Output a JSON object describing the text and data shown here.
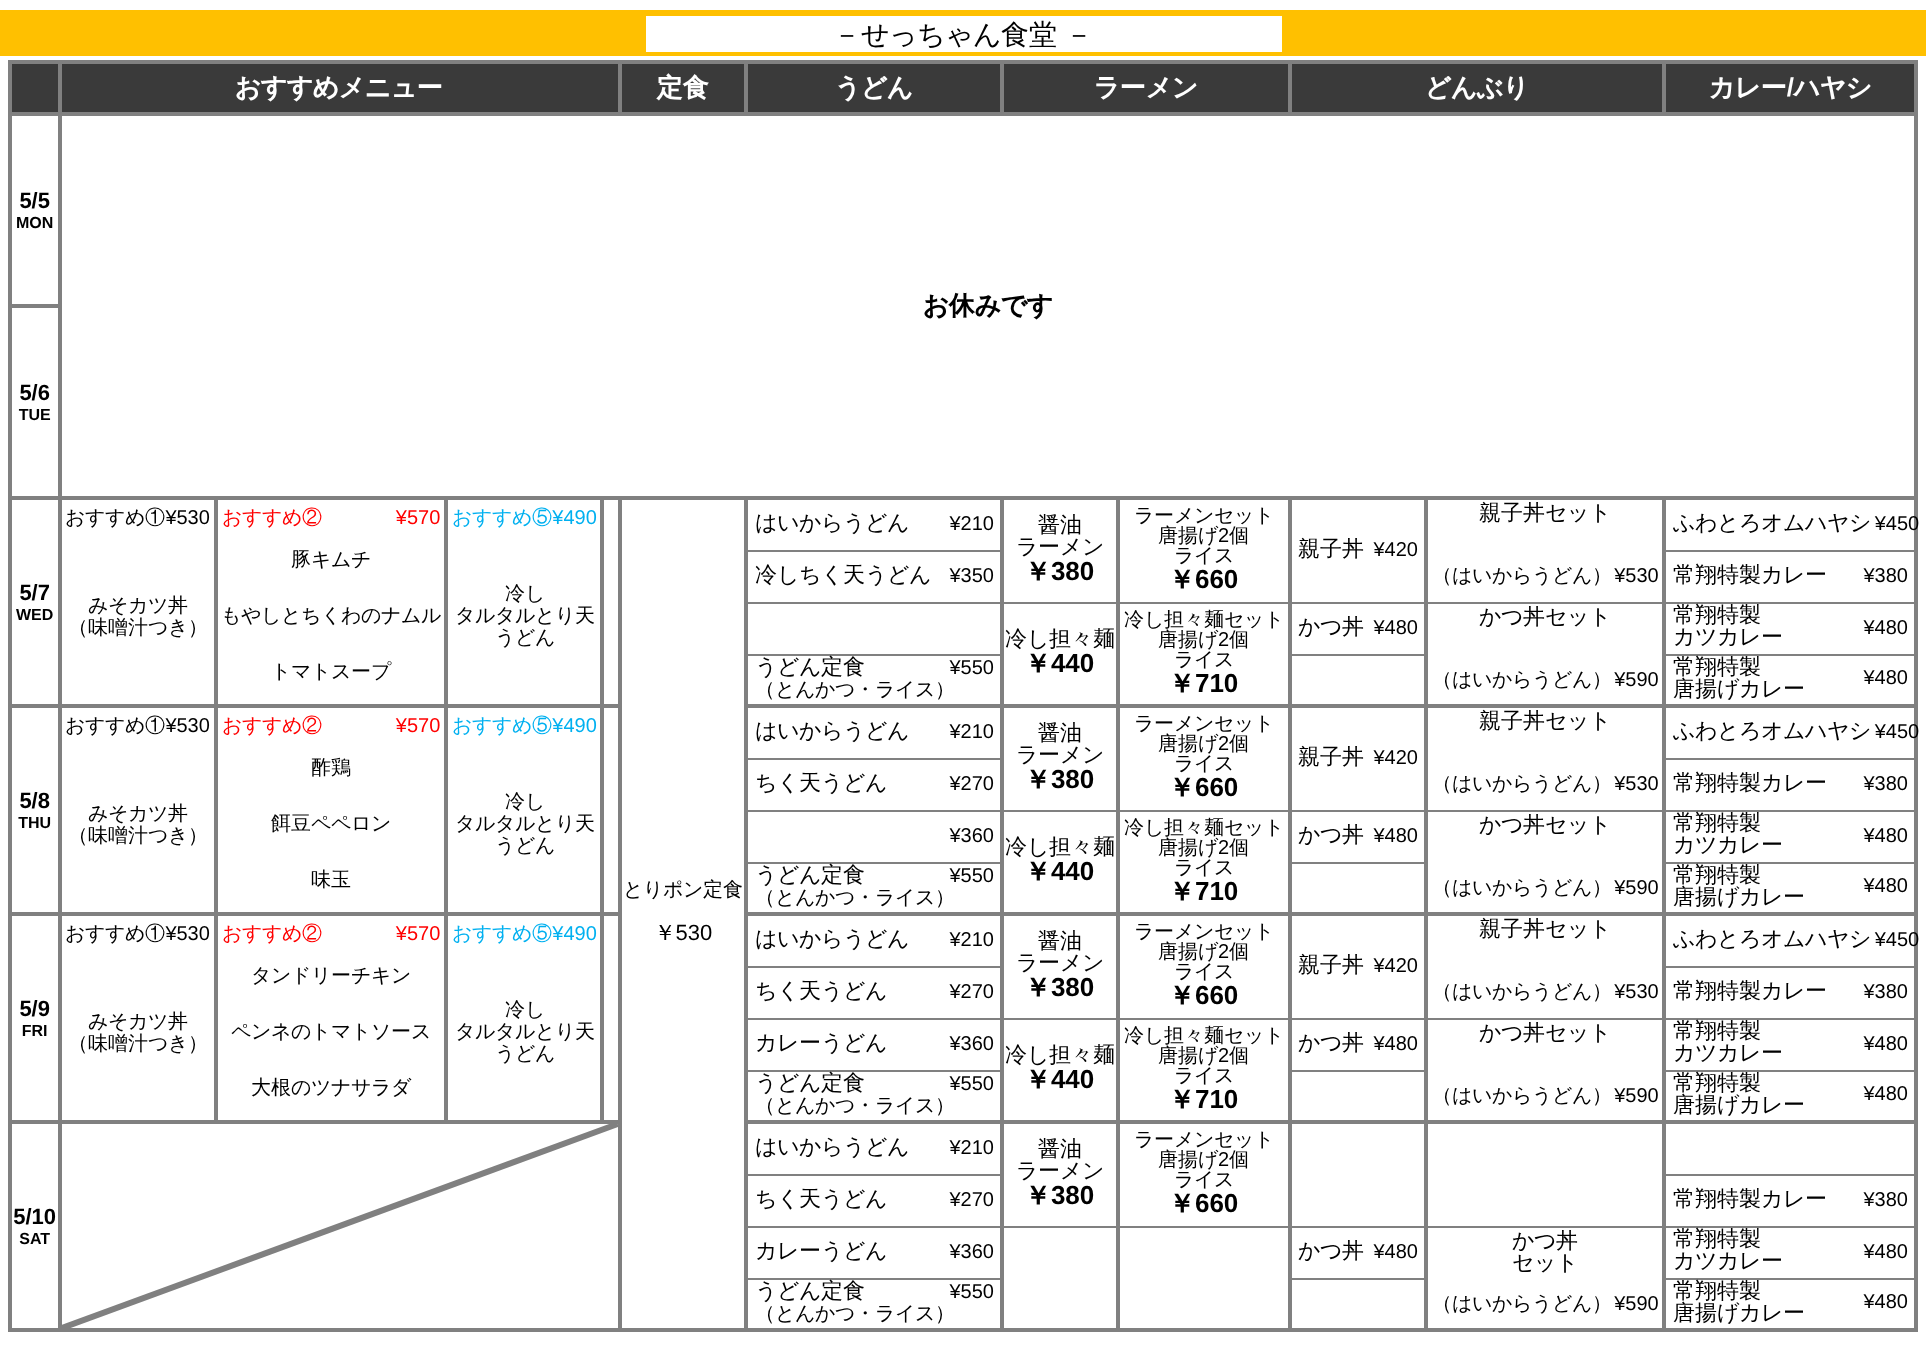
{
  "title": "－せっちゃん食堂 －",
  "columns": [
    {
      "label": "おすすめメニュー"
    },
    {
      "label": "定食"
    },
    {
      "label": "うどん"
    },
    {
      "label": "ラーメン"
    },
    {
      "label": "どんぶり"
    },
    {
      "label": "カレー/ハヤシ"
    }
  ],
  "closed_notice": "お休みです",
  "set_meal": {
    "name": "とりポン定食",
    "price": "￥530"
  },
  "days": [
    {
      "date": "5/5",
      "weekday": "MON",
      "kind": "closed"
    },
    {
      "date": "5/6",
      "weekday": "TUE",
      "kind": "closed"
    },
    {
      "date": "5/7",
      "weekday": "WED",
      "kind": "open",
      "specials_struck": false,
      "specials": [
        {
          "kind": "single",
          "title": "おすすめ①",
          "price": "¥530",
          "color": "#000000",
          "lines": [
            "みそカツ丼"
          ],
          "note": "（味噌汁つき）"
        },
        {
          "kind": "list",
          "title": "おすすめ②",
          "price": "¥570",
          "color": "#ff0000",
          "lines": [
            "豚キムチ",
            "もやしとちくわのナムル",
            "トマトスープ"
          ]
        },
        {
          "kind": "single",
          "title": "おすすめ⑤",
          "price": "¥490",
          "color": "#00b0f0",
          "lines": [
            "冷し",
            "タルタルとり天",
            "うどん"
          ]
        }
      ],
      "udon": [
        {
          "kind": "item",
          "lines": [
            "はいからうどん"
          ],
          "price": "¥210"
        },
        {
          "kind": "item",
          "lines": [
            "冷しちく天うどん"
          ],
          "price": "¥350"
        },
        {
          "kind": "blank"
        },
        {
          "kind": "item",
          "lines": [
            "うどん定食"
          ],
          "note": "（とんかつ・ライス）",
          "price": "¥550"
        }
      ],
      "ramen": [
        {
          "kind": "item",
          "lines": [
            "醤油",
            "ラーメン"
          ],
          "price": "￥380"
        },
        {
          "kind": "item",
          "lines": [
            "冷し担々麺"
          ],
          "price": "￥440"
        }
      ],
      "ramen_sets": [
        {
          "kind": "item",
          "lines": [
            "ラーメンセット",
            "唐揚げ2個",
            "ライス"
          ],
          "price": "￥660"
        },
        {
          "kind": "item",
          "lines": [
            "冷し担々麺セット",
            "唐揚げ2個",
            "ライス"
          ],
          "price": "￥710"
        }
      ],
      "bowls": [
        {
          "kind": "item",
          "lines": [
            "親子丼"
          ],
          "price": "¥420"
        },
        {
          "kind": "item",
          "lines": [
            "かつ丼"
          ],
          "price": "¥480"
        }
      ],
      "bowl_sets": [
        {
          "kind": "item",
          "lines": [
            "親子丼セット"
          ],
          "note": "（はいからうどん）",
          "price": "¥530"
        },
        {
          "kind": "item",
          "lines": [
            "かつ丼セット"
          ],
          "note": "（はいからうどん）",
          "price": "¥590"
        }
      ],
      "curry": [
        {
          "kind": "item",
          "lines": [
            "ふわとろオムハヤシ"
          ],
          "price": "¥450"
        },
        {
          "kind": "item",
          "lines": [
            "常翔特製カレー"
          ],
          "price": "¥380"
        },
        {
          "kind": "item",
          "lines": [
            "常翔特製",
            "カツカレー"
          ],
          "price": "¥480"
        },
        {
          "kind": "item",
          "lines": [
            "常翔特製",
            "唐揚げカレー"
          ],
          "price": "¥480"
        }
      ]
    },
    {
      "date": "5/8",
      "weekday": "THU",
      "kind": "open",
      "specials_struck": false,
      "specials": [
        {
          "kind": "single",
          "title": "おすすめ①",
          "price": "¥530",
          "color": "#000000",
          "lines": [
            "みそカツ丼"
          ],
          "note": "（味噌汁つき）"
        },
        {
          "kind": "list",
          "title": "おすすめ②",
          "price": "¥570",
          "color": "#ff0000",
          "lines": [
            "酢鶏",
            "餌豆ペペロン",
            "味玉"
          ]
        },
        {
          "kind": "single",
          "title": "おすすめ⑤",
          "price": "¥490",
          "color": "#00b0f0",
          "lines": [
            "冷し",
            "タルタルとり天",
            "うどん"
          ]
        }
      ],
      "udon": [
        {
          "kind": "item",
          "lines": [
            "はいからうどん"
          ],
          "price": "¥210"
        },
        {
          "kind": "item",
          "lines": [
            "ちく天うどん"
          ],
          "price": "¥270"
        },
        {
          "kind": "item",
          "price": "¥360"
        },
        {
          "kind": "item",
          "lines": [
            "うどん定食"
          ],
          "note": "（とんかつ・ライス）",
          "price": "¥550"
        }
      ],
      "ramen": [
        {
          "kind": "item",
          "lines": [
            "醤油",
            "ラーメン"
          ],
          "price": "￥380"
        },
        {
          "kind": "item",
          "lines": [
            "冷し担々麺"
          ],
          "price": "￥440"
        }
      ],
      "ramen_sets": [
        {
          "kind": "item",
          "lines": [
            "ラーメンセット",
            "唐揚げ2個",
            "ライス"
          ],
          "price": "￥660"
        },
        {
          "kind": "item",
          "lines": [
            "冷し担々麺セット",
            "唐揚げ2個",
            "ライス"
          ],
          "price": "￥710"
        }
      ],
      "bowls": [
        {
          "kind": "item",
          "lines": [
            "親子丼"
          ],
          "price": "¥420"
        },
        {
          "kind": "item",
          "lines": [
            "かつ丼"
          ],
          "price": "¥480"
        }
      ],
      "bowl_sets": [
        {
          "kind": "item",
          "lines": [
            "親子丼セット"
          ],
          "note": "（はいからうどん）",
          "price": "¥530"
        },
        {
          "kind": "item",
          "lines": [
            "かつ丼セット"
          ],
          "note": "（はいからうどん）",
          "price": "¥590"
        }
      ],
      "curry": [
        {
          "kind": "item",
          "lines": [
            "ふわとろオムハヤシ"
          ],
          "price": "¥450"
        },
        {
          "kind": "item",
          "lines": [
            "常翔特製カレー"
          ],
          "price": "¥380"
        },
        {
          "kind": "item",
          "lines": [
            "常翔特製",
            "カツカレー"
          ],
          "price": "¥480"
        },
        {
          "kind": "item",
          "lines": [
            "常翔特製",
            "唐揚げカレー"
          ],
          "price": "¥480"
        }
      ]
    },
    {
      "date": "5/9",
      "weekday": "FRI",
      "kind": "open",
      "specials_struck": false,
      "specials": [
        {
          "kind": "single",
          "title": "おすすめ①",
          "price": "¥530",
          "color": "#000000",
          "lines": [
            "みそカツ丼"
          ],
          "note": "（味噌汁つき）"
        },
        {
          "kind": "list",
          "title": "おすすめ②",
          "price": "¥570",
          "color": "#ff0000",
          "lines": [
            "タンドリーチキン",
            "ペンネのトマトソース",
            "大根のツナサラダ"
          ]
        },
        {
          "kind": "single",
          "title": "おすすめ⑤",
          "price": "¥490",
          "color": "#00b0f0",
          "lines": [
            "冷し",
            "タルタルとり天",
            "うどん"
          ]
        }
      ],
      "udon": [
        {
          "kind": "item",
          "lines": [
            "はいからうどん"
          ],
          "price": "¥210"
        },
        {
          "kind": "item",
          "lines": [
            "ちく天うどん"
          ],
          "price": "¥270"
        },
        {
          "kind": "item",
          "lines": [
            "カレーうどん"
          ],
          "price": "¥360"
        },
        {
          "kind": "item",
          "lines": [
            "うどん定食"
          ],
          "note": "（とんかつ・ライス）",
          "price": "¥550"
        }
      ],
      "ramen": [
        {
          "kind": "item",
          "lines": [
            "醤油",
            "ラーメン"
          ],
          "price": "￥380"
        },
        {
          "kind": "item",
          "lines": [
            "冷し担々麺"
          ],
          "price": "￥440"
        }
      ],
      "ramen_sets": [
        {
          "kind": "item",
          "lines": [
            "ラーメンセット",
            "唐揚げ2個",
            "ライス"
          ],
          "price": "￥660"
        },
        {
          "kind": "item",
          "lines": [
            "冷し担々麺セット",
            "唐揚げ2個",
            "ライス"
          ],
          "price": "￥710"
        }
      ],
      "bowls": [
        {
          "kind": "item",
          "lines": [
            "親子丼"
          ],
          "price": "¥420"
        },
        {
          "kind": "item",
          "lines": [
            "かつ丼"
          ],
          "price": "¥480"
        }
      ],
      "bowl_sets": [
        {
          "kind": "item",
          "lines": [
            "親子丼セット"
          ],
          "note": "（はいからうどん）",
          "price": "¥530"
        },
        {
          "kind": "item",
          "lines": [
            "かつ丼セット"
          ],
          "note": "（はいからうどん）",
          "price": "¥590"
        }
      ],
      "curry": [
        {
          "kind": "item",
          "lines": [
            "ふわとろオムハヤシ"
          ],
          "price": "¥450"
        },
        {
          "kind": "item",
          "lines": [
            "常翔特製カレー"
          ],
          "price": "¥380"
        },
        {
          "kind": "item",
          "lines": [
            "常翔特製",
            "カツカレー"
          ],
          "price": "¥480"
        },
        {
          "kind": "item",
          "lines": [
            "常翔特製",
            "唐揚げカレー"
          ],
          "price": "¥480"
        }
      ]
    },
    {
      "date": "5/10",
      "weekday": "SAT",
      "kind": "open",
      "specials_struck": true,
      "udon": [
        {
          "kind": "item",
          "lines": [
            "はいからうどん"
          ],
          "price": "¥210"
        },
        {
          "kind": "item",
          "lines": [
            "ちく天うどん"
          ],
          "price": "¥270"
        },
        {
          "kind": "item",
          "lines": [
            "カレーうどん"
          ],
          "price": "¥360"
        },
        {
          "kind": "item",
          "lines": [
            "うどん定食"
          ],
          "note": "（とんかつ・ライス）",
          "price": "¥550"
        }
      ],
      "ramen": [
        {
          "kind": "item",
          "lines": [
            "醤油",
            "ラーメン"
          ],
          "price": "￥380"
        },
        {
          "kind": "blank"
        }
      ],
      "ramen_sets": [
        {
          "kind": "item",
          "lines": [
            "ラーメンセット",
            "唐揚げ2個",
            "ライス"
          ],
          "price": "￥660"
        },
        {
          "kind": "blank"
        }
      ],
      "bowls": [
        {
          "kind": "blank"
        },
        {
          "kind": "item",
          "lines": [
            "かつ丼"
          ],
          "price": "¥480"
        }
      ],
      "bowl_sets": [
        {
          "kind": "blank"
        },
        {
          "kind": "item",
          "lines": [
            "かつ丼",
            "セット"
          ],
          "note": "（はいからうどん）",
          "price": "¥590"
        }
      ],
      "curry": [
        {
          "kind": "blank"
        },
        {
          "kind": "item",
          "lines": [
            "常翔特製カレー"
          ],
          "price": "¥380"
        },
        {
          "kind": "item",
          "lines": [
            "常翔特製",
            "カツカレー"
          ],
          "price": "¥480"
        },
        {
          "kind": "item",
          "lines": [
            "常翔特製",
            "唐揚げカレー"
          ],
          "price": "¥480"
        }
      ]
    }
  ]
}
